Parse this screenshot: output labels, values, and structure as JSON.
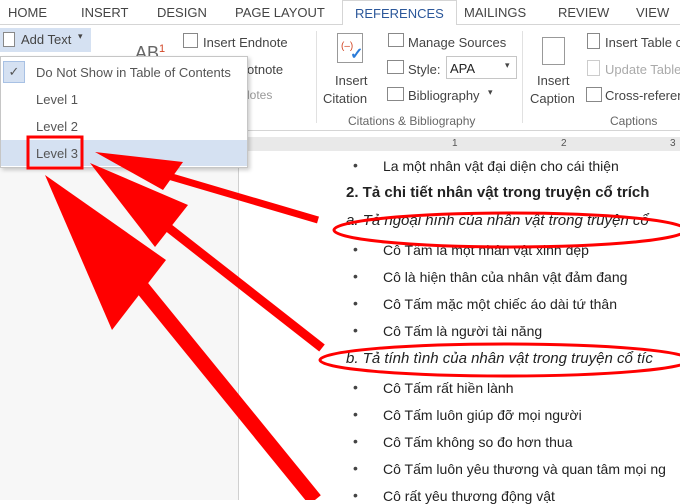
{
  "tabs": [
    "HOME",
    "INSERT",
    "DESIGN",
    "PAGE LAYOUT",
    "REFERENCES",
    "MAILINGS",
    "REVIEW",
    "VIEW"
  ],
  "active_tab": "REFERENCES",
  "ribbon": {
    "add_text": "Add Text",
    "insert_endnote": "Insert Endnote",
    "footnote_partial": "otnote",
    "footnotes_group_partial": "lotes",
    "insert_citation": [
      "Insert",
      "Citation"
    ],
    "manage_sources": "Manage Sources",
    "style_label": "Style:",
    "style_value": "APA",
    "bibliography": "Bibliography",
    "citations_group": "Citations & Bibliography",
    "insert_caption": [
      "Insert",
      "Caption"
    ],
    "insert_table": "Insert Table o",
    "update_table": "Update Table",
    "cross_reference": "Cross-referen",
    "captions_group": "Captions"
  },
  "menu": {
    "items": [
      "Do Not Show in Table of Contents",
      "Level 1",
      "Level 2",
      "Level 3"
    ],
    "checked": "Do Not Show in Table of Contents",
    "highlighted": "Level 3"
  },
  "ruler": [
    "1",
    "2",
    "3"
  ],
  "document": {
    "bullet0": "La một nhân vật đại diện cho cái thiện",
    "heading": "2. Tả chi tiết nhân vật trong truyện cổ trích",
    "sub_a": "a. Tả ngoại hình của nhân vật trong truyện cổ",
    "list_a": [
      "Cô Tấm là một nhân vật xinh đẹp",
      "Cô là hiện thân của nhân vật đảm đang",
      "Cô Tấm mặc một chiếc áo dài tứ thân",
      "Cô Tấm là người tài năng"
    ],
    "sub_b": "b. Tả tính tình của nhân vật trong truyện cổ tíc",
    "list_b": [
      "Cô Tấm rất hiền lành",
      "Cô Tấm luôn giúp đỡ mọi người",
      "Cô Tấm không so đo hơn thua",
      "Cô Tấm luôn yêu thương và quan tâm mọi ng",
      "Cô rất yêu thương động vật"
    ]
  },
  "colors": {
    "accent": "#2b579a",
    "annotation": "#ff0000",
    "highlight": "#d5e1f2"
  }
}
